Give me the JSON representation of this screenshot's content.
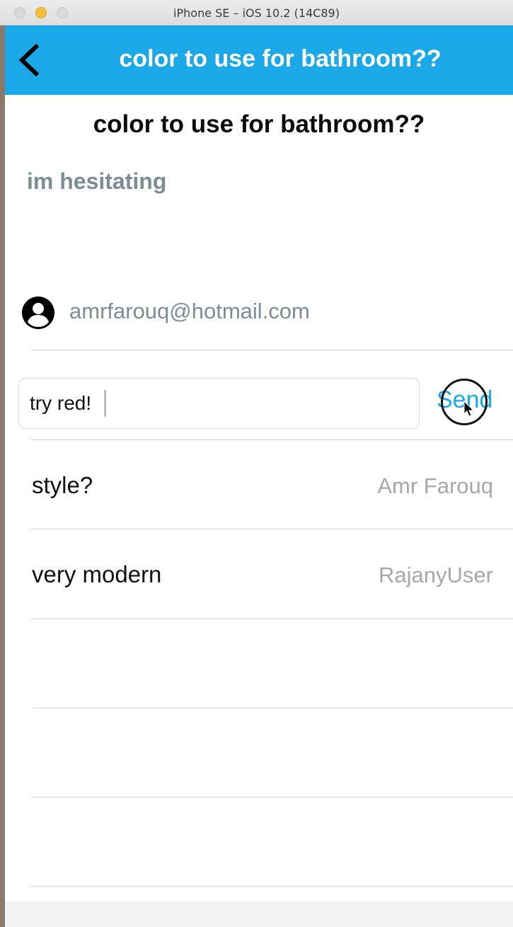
{
  "window": {
    "title": "iPhone SE – iOS 10.2 (14C89)"
  },
  "navbar": {
    "title": "color to use for bathroom??",
    "back_icon": "chevron-left-icon"
  },
  "post": {
    "title": "color to use for bathroom??",
    "body": "im hesitating",
    "author_icon": "user-circle-icon",
    "author_email": "amrfarouq@hotmail.com"
  },
  "reply": {
    "input_value": "try red!",
    "send_label": "Send"
  },
  "comments": [
    {
      "text": "style?",
      "author": "Amr Farouq"
    },
    {
      "text": "very modern",
      "author": "RajanyUser"
    },
    {
      "text": "",
      "author": ""
    },
    {
      "text": "",
      "author": ""
    },
    {
      "text": "",
      "author": ""
    }
  ],
  "colors": {
    "accent": "#1ba8e9",
    "muted_text": "#7b8d97",
    "secondary_text": "#a8a8a8"
  }
}
